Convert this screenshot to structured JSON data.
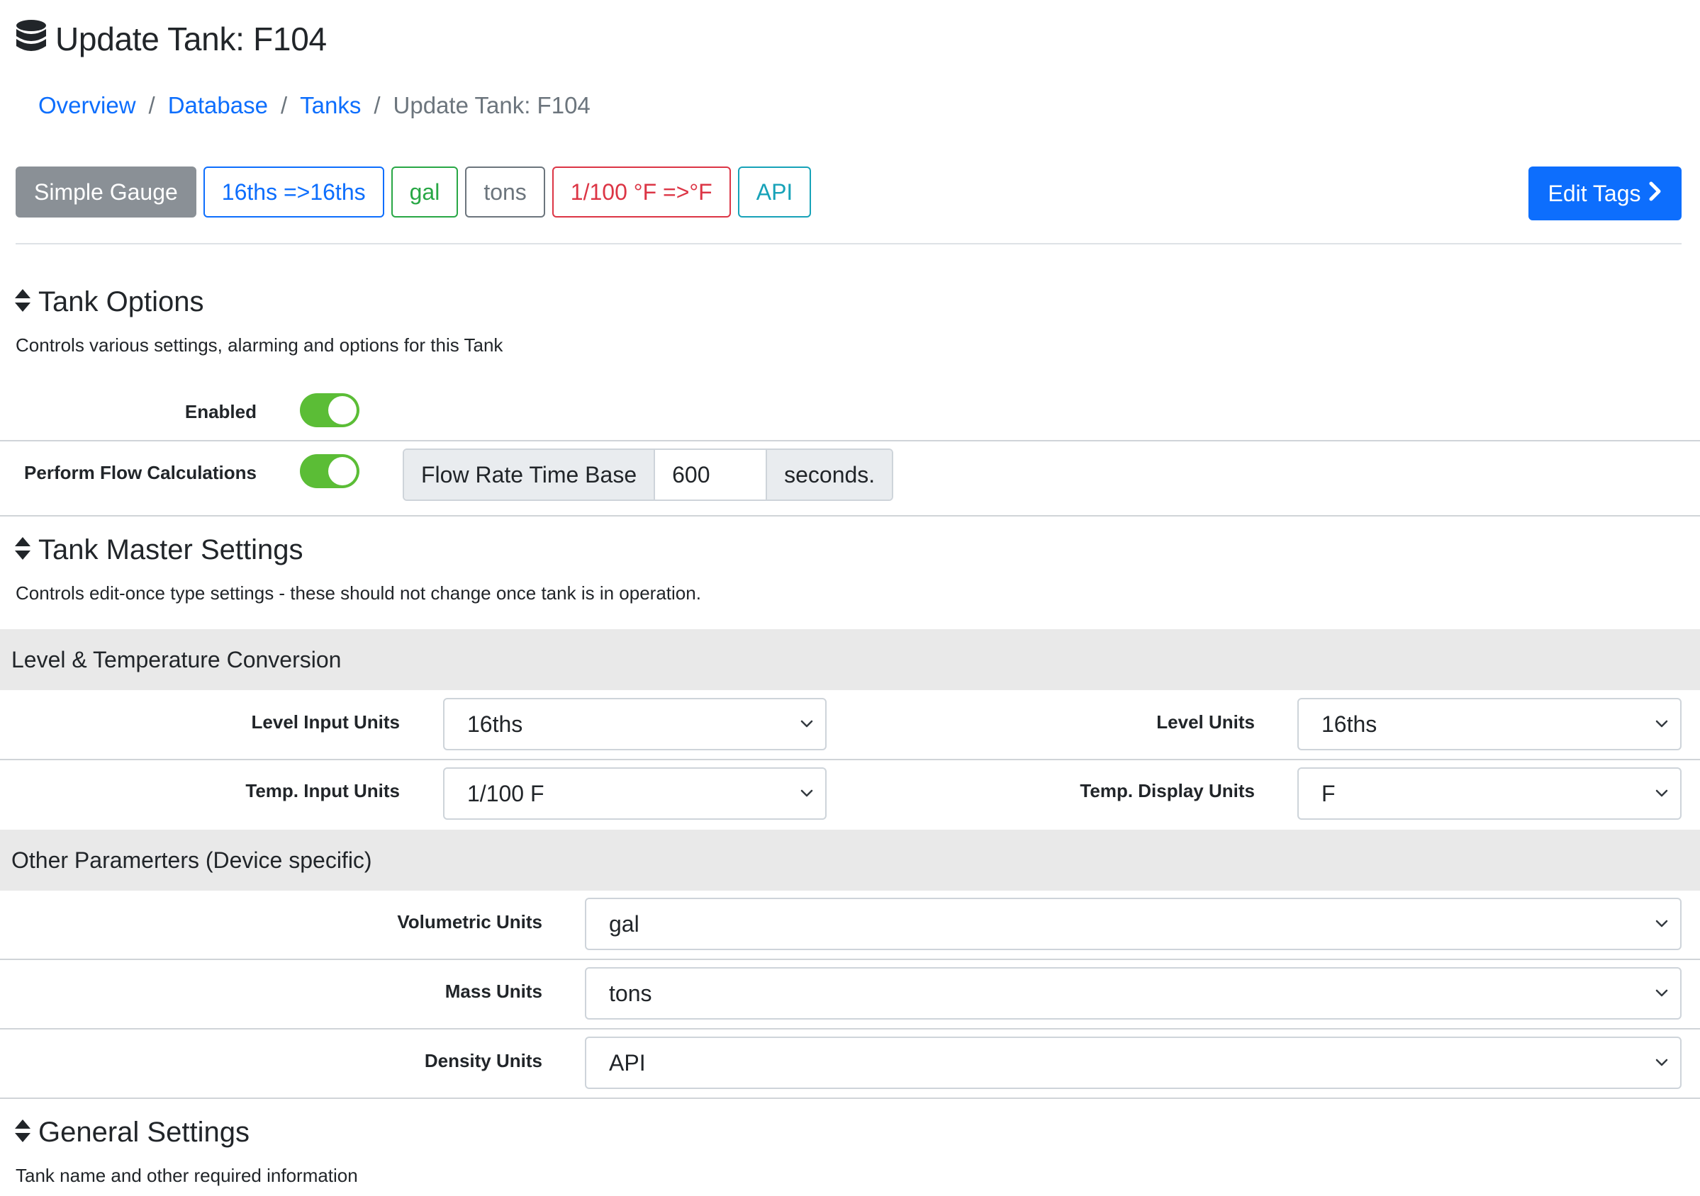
{
  "page": {
    "title": "Update Tank: F104"
  },
  "breadcrumb": [
    {
      "label": "Overview"
    },
    {
      "label": "Database"
    },
    {
      "label": "Tanks"
    },
    {
      "label": "Update Tank: F104"
    }
  ],
  "tags": [
    {
      "label": "Simple Gauge",
      "style": "gray"
    },
    {
      "label": "16ths =>16ths",
      "style": "blue"
    },
    {
      "label": "gal",
      "style": "green"
    },
    {
      "label": "tons",
      "style": "muted"
    },
    {
      "label": "1/100 °F =>°F",
      "style": "red"
    },
    {
      "label": "API",
      "style": "teal"
    }
  ],
  "edit_tags": {
    "label": "Edit Tags"
  },
  "sections": {
    "tank_options": {
      "title": "Tank Options",
      "description": "Controls various settings, alarming and options for this Tank",
      "enabled": {
        "label": "Enabled",
        "checked": true
      },
      "flow": {
        "label": "Perform Flow Calculations",
        "checked": true,
        "prefix": "Flow Rate Time Base",
        "value": "600",
        "suffix": "seconds."
      }
    },
    "tank_master": {
      "title": "Tank Master Settings",
      "description": "Controls edit-once type settings - these should not change once tank is in operation.",
      "level_temp": {
        "title": "Level & Temperature Conversion",
        "level_input_units": {
          "label": "Level Input Units",
          "value": "16ths"
        },
        "level_units": {
          "label": "Level Units",
          "value": "16ths"
        },
        "temp_input_units": {
          "label": "Temp. Input Units",
          "value": "1/100 F"
        },
        "temp_display_units": {
          "label": "Temp. Display Units",
          "value": "F"
        }
      },
      "other": {
        "title": "Other Paramerters (Device specific)",
        "volumetric_units": {
          "label": "Volumetric Units",
          "value": "gal"
        },
        "mass_units": {
          "label": "Mass Units",
          "value": "tons"
        },
        "density_units": {
          "label": "Density Units",
          "value": "API"
        }
      }
    },
    "general": {
      "title": "General Settings",
      "description": "Tank name and other required information"
    }
  },
  "colors": {
    "link": "#0d6efd",
    "primary": "#0d6efd",
    "toggle_on": "#5bbd36",
    "band_bg": "#e9e9e9"
  },
  "icons": {
    "title_icon": "database-icon",
    "section_icon": "sort-icon",
    "edit_tags_icon": "chevron-right-icon",
    "select_icon": "chevron-down-icon"
  }
}
